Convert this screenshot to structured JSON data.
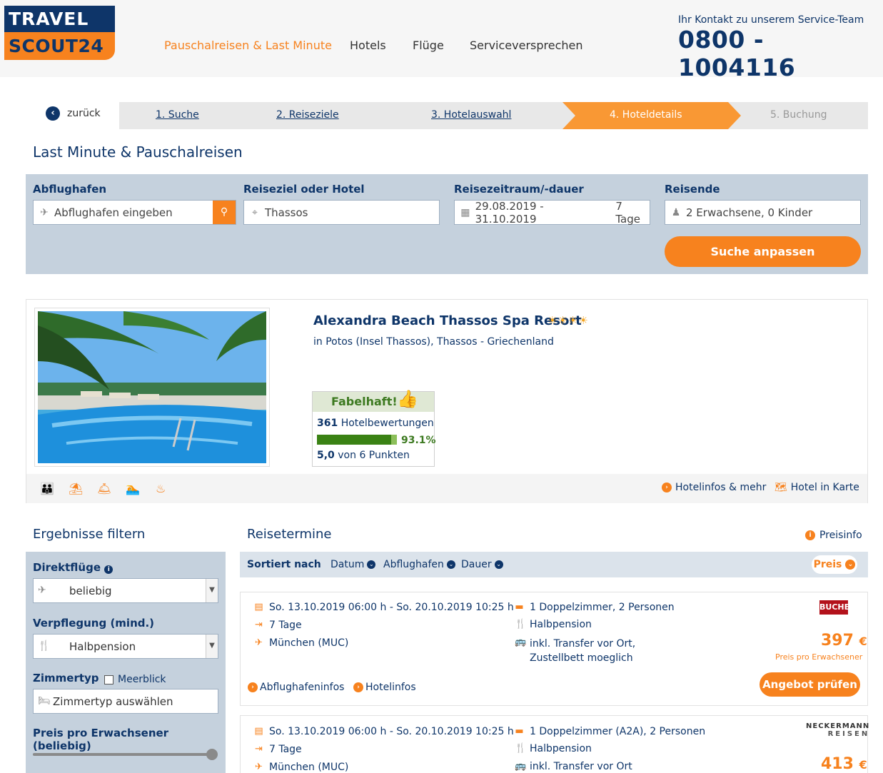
{
  "header": {
    "logo_top": "TRAVEL",
    "logo_bottom": "SCOUT24",
    "nav": [
      "Pauschalreisen & Last Minute",
      "Hotels",
      "Flüge",
      "Serviceversprechen"
    ],
    "contact_label": "Ihr Kontakt zu unserem Service-Team",
    "contact_phone": "0800 - 1004116"
  },
  "steps": {
    "back": "zurück",
    "items": [
      "1. Suche",
      "2. Reiseziele",
      "3. Hotelauswahl",
      "4. Hoteldetails",
      "5. Buchung"
    ]
  },
  "page_title": "Last Minute & Pauschalreisen",
  "search": {
    "airport_label": "Abflughafen",
    "airport_placeholder": "Abflughafen eingeben",
    "dest_label": "Reiseziel oder Hotel",
    "dest_value": "Thassos",
    "date_label": "Reisezeitraum/-dauer",
    "date_value": "29.08.2019 - 31.10.2019",
    "duration_value": "7 Tage",
    "travellers_label": "Reisende",
    "travellers_value": "2 Erwachsene, 0 Kinder",
    "submit": "Suche anpassen"
  },
  "hotel": {
    "name": "Alexandra Beach Thassos Spa Resort",
    "stars": "☀☀☀☀",
    "location": "in Potos (Insel Thassos), Thassos - Griechenland",
    "rating_label": "Fabelhaft!",
    "review_count": "361",
    "review_label": "Hotelbewertungen",
    "recommend_pct": 93.1,
    "recommend_text": "93.1%",
    "points": "5,0",
    "points_suffix": "von 6 Punkten",
    "amenities": [
      "family-icon",
      "beach-icon",
      "service-bell-icon",
      "swimming-icon",
      "spa-icon"
    ],
    "link_info": "Hotelinfos & mehr",
    "link_map": "Hotel in Karte"
  },
  "filters": {
    "title": "Ergebnisse filtern",
    "direct_label": "Direktflüge",
    "direct_value": "beliebig",
    "board_label": "Verpflegung (mind.)",
    "board_value": "Halbpension",
    "room_label": "Zimmertyp",
    "seaview_label": "Meerblick",
    "room_placeholder": "Zimmertyp auswählen",
    "price_label": "Preis pro Erwachsener (beliebig)"
  },
  "results": {
    "title": "Reisetermine",
    "preisinfo": "Preisinfo",
    "sort_label": "Sortiert nach",
    "sort_options": [
      "Datum",
      "Abflughafen",
      "Dauer"
    ],
    "sort_active": "Preis",
    "offers": [
      {
        "dates": "So. 13.10.2019 06:00 h - So. 20.10.2019 10:25 h",
        "duration": "7 Tage",
        "airport": "München (MUC)",
        "room": "1 Doppelzimmer, 2 Personen",
        "board": "Halbpension",
        "transfer": "inkl. Transfer vor Ort, Zustellbett moeglich",
        "operator": "BUCHER",
        "price": "397",
        "currency": "€",
        "price_note": "Preis pro Erwachsener",
        "cta": "Angebot prüfen",
        "link_airport": "Abflughafeninfos",
        "link_hotel": "Hotelinfos"
      },
      {
        "dates": "So. 13.10.2019 06:00 h - So. 20.10.2019 10:25 h",
        "duration": "7 Tage",
        "airport": "München (MUC)",
        "room": "1 Doppelzimmer (A2A), 2 Personen",
        "board": "Halbpension",
        "transfer": "inkl. Transfer vor Ort",
        "operator_line1": "NECKERMANN",
        "operator_line2": "REISEN",
        "price": "413",
        "currency": "€"
      }
    ]
  },
  "colors": {
    "brand_navy": "#0e3569",
    "brand_orange": "#f7821e"
  }
}
